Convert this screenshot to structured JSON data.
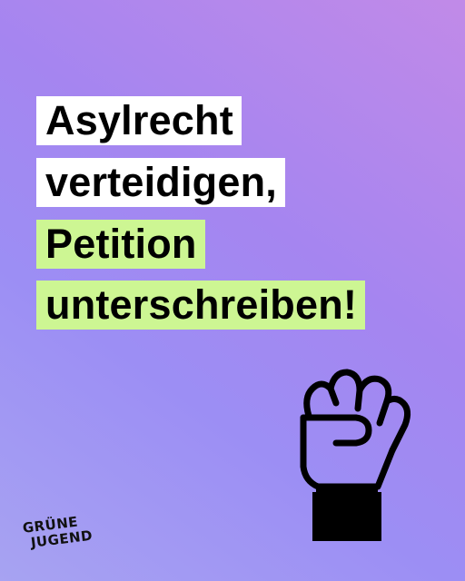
{
  "headline": {
    "lines": [
      "Asylrecht",
      "verteidigen,",
      "Petition",
      "unterschreiben!"
    ]
  },
  "brand": {
    "line1": "GRÜNE",
    "line2": "JUGEND"
  },
  "illustration": {
    "icon": "raised-fist-icon"
  },
  "colors": {
    "background_start": "#a7a3f2",
    "background_end": "#c18ae8",
    "highlight_white": "#ffffff",
    "highlight_green": "#cdf693",
    "text": "#000000"
  }
}
